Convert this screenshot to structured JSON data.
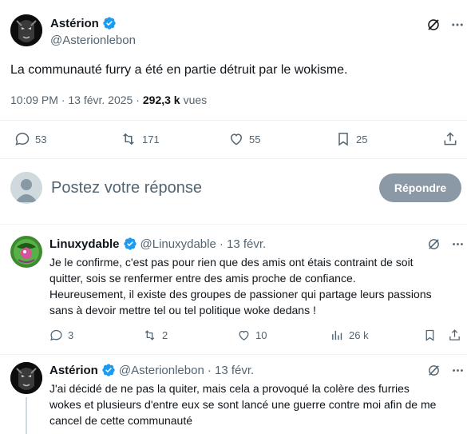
{
  "tweet": {
    "author_name": "Astérion",
    "author_handle": "@Asterionlebon",
    "text": "La communauté furry a été en partie détruit par le wokisme.",
    "time": "10:09 PM · 13 févr. 2025 ·",
    "views_count": "292,3 k",
    "views_label": "vues",
    "replies": "53",
    "retweets": "171",
    "likes": "55",
    "bookmarks": "25"
  },
  "compose": {
    "placeholder": "Postez votre réponse",
    "button_label": "Répondre"
  },
  "replies": [
    {
      "author_name": "Linuxydable",
      "author_handle": "@Linuxydable",
      "date": "· 13 févr.",
      "text_lines": [
        "Je le confirme, c'est pas pour rien que des amis ont étais contraint de soit",
        "quitter, sois se renfermer entre des amis proche de confiance.",
        "Heureusement, il existe des groupes de passioner qui partage leurs passions",
        "sans à devoir mettre tel ou tel politique woke dedans !"
      ],
      "replies": "3",
      "retweets": "2",
      "likes": "10",
      "views": "26 k"
    },
    {
      "author_name": "Astérion",
      "author_handle": "@Asterionlebon",
      "date": "· 13 févr.",
      "text_lines": [
        "J'ai décidé de ne pas la quiter, mais cela a provoqué la colère des furries",
        "wokes et plusieurs d'entre eux se sont lancé une guerre contre moi afin de me",
        "cancel de cette communauté"
      ]
    }
  ],
  "colors": {
    "verified": "#1d9bf0",
    "muted": "#536471",
    "reply_button": "#8b98a5",
    "divider": "#eff3f4"
  },
  "icons": [
    "verified-icon",
    "grok-icon",
    "more-icon",
    "reply-icon",
    "retweet-icon",
    "like-icon",
    "bookmark-icon",
    "share-icon",
    "views-icon",
    "default-avatar-icon"
  ]
}
